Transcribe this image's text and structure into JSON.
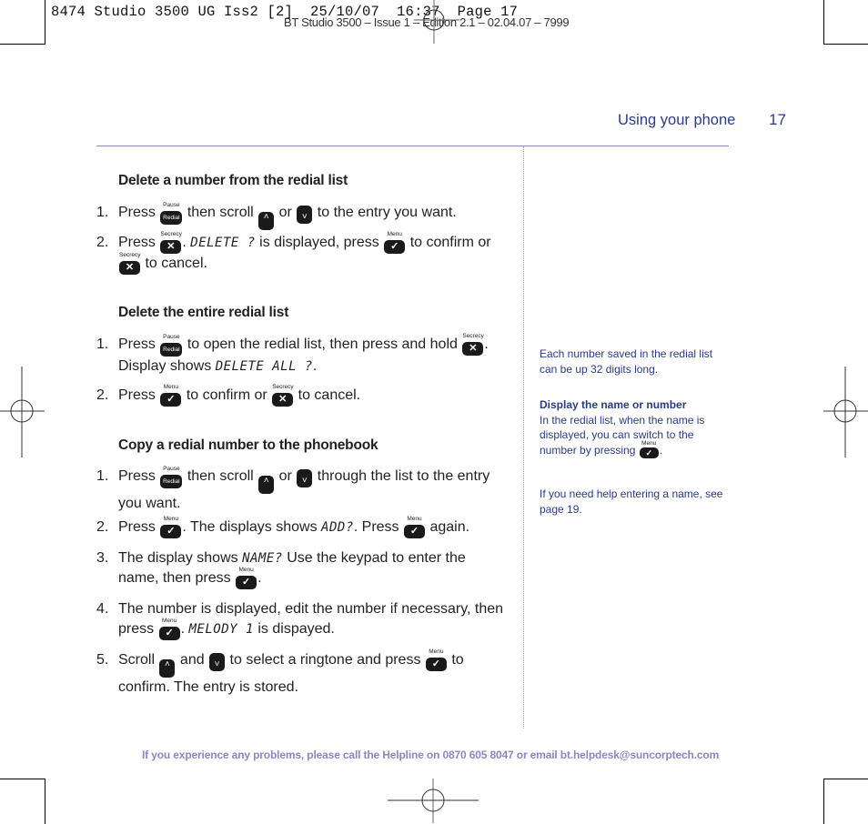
{
  "print_slug": "8474 Studio 3500 UG Iss2 [2]  25/10/07  16:37  Page 17",
  "print_subslug": "BT Studio 3500 – Issue 1 – Edition 2.1 – 02.04.07 – 7999",
  "header": {
    "section": "Using your phone",
    "page_number": "17"
  },
  "keys": {
    "redial": {
      "label_top": "Pause",
      "label": "Redial"
    },
    "secrecy": {
      "label_top": "Secrecy",
      "glyph": "✕"
    },
    "menu": {
      "label_top": "Menu",
      "glyph": "✓"
    },
    "up": {
      "glyph": "˄"
    },
    "down": {
      "glyph": "˅"
    }
  },
  "sections": [
    {
      "title": "Delete a number from the redial list",
      "items": [
        {
          "num": "1.",
          "parts": [
            "Press",
            "then scroll",
            "or",
            "to the entry you want."
          ]
        },
        {
          "num": "2.",
          "parts": [
            "Press",
            ".",
            "DELETE ?",
            "is displayed, press",
            "to confirm or",
            "to cancel."
          ]
        }
      ]
    },
    {
      "title": "Delete the entire redial list",
      "items": [
        {
          "num": "1.",
          "parts": [
            "Press",
            "to open the redial list, then press and hold",
            ".",
            "Display shows",
            "DELETE ALL ?",
            "."
          ]
        },
        {
          "num": "2.",
          "parts": [
            "Press",
            "to confirm or",
            "to cancel."
          ]
        }
      ]
    },
    {
      "title": "Copy a redial number to the phonebook",
      "items": [
        {
          "num": "1.",
          "parts": [
            "Press",
            "then scroll",
            "or",
            "through the list to the entry you want."
          ]
        },
        {
          "num": "2.",
          "parts": [
            "Press",
            ". The displays shows",
            "ADD?",
            ". Press",
            "again."
          ]
        },
        {
          "num": "3.",
          "parts": [
            "The display shows",
            "NAME?",
            "Use the keypad to enter the name, then press",
            "."
          ]
        },
        {
          "num": "4.",
          "parts": [
            "The number is displayed, edit the number if necessary, then press",
            ".",
            "MELODY 1",
            "is dispayed."
          ]
        },
        {
          "num": "5.",
          "parts": [
            "Scroll",
            "and",
            "to select a ringtone and press",
            "to confirm. The entry is stored."
          ]
        }
      ]
    }
  ],
  "sidebar": {
    "note1": "Each number saved in the redial list can be up 32 digits long.",
    "note2_title": "Display the name or number",
    "note2_text": "In the redial list, when the name is displayed, you can switch to the number by pressing",
    "note2_end": ".",
    "note3": "If you need help entering a name, see page 19."
  },
  "footer": "If you experience any problems, please call the Helpline on 0870 605 8047 or email bt.helpdesk@suncorptech.com",
  "colors": {
    "brand_blue": "#2b3a8c",
    "rule_lilac": "#8b87c4",
    "footer_lilac": "#8b87c4"
  }
}
